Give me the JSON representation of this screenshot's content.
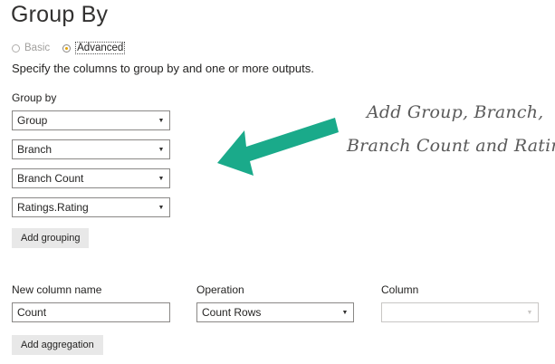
{
  "dialog": {
    "title": "Group By",
    "radios": [
      {
        "label": "Basic",
        "selected": false
      },
      {
        "label": "Advanced",
        "selected": true
      }
    ],
    "description": "Specify the columns to group by and one or more outputs."
  },
  "group_by": {
    "label": "Group by",
    "dropdowns": [
      "Group",
      "Branch",
      "Branch Count",
      "Ratings.Rating"
    ],
    "add_grouping_label": "Add grouping"
  },
  "aggregation": {
    "new_column_name_label": "New column name",
    "operation_label": "Operation",
    "column_label": "Column",
    "new_column_value": "Count",
    "operation_value": "Count Rows",
    "column_value": "",
    "add_aggregation_label": "Add aggregation"
  },
  "annotation": {
    "line1": "Add Group, Branch,",
    "line2": "Branch Count and Ratings",
    "arrow_color": "#1aaa8a"
  },
  "colors": {
    "radio_accent": "#e1a100",
    "button_bg": "#e8e8e8"
  },
  "icons": {
    "dropdown": "chevron-down-icon",
    "arrow": "arrow-left-icon"
  }
}
